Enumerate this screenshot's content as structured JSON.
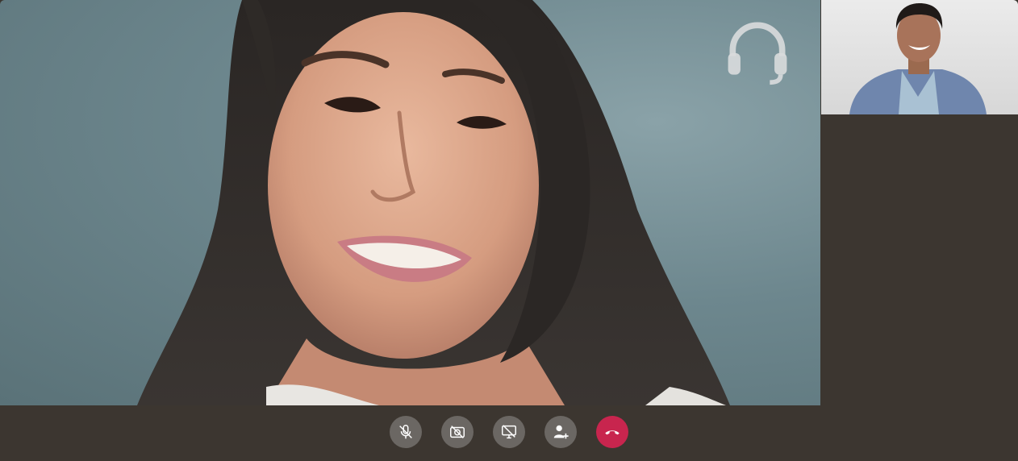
{
  "call": {
    "main_participant": {
      "video_state": "on",
      "audio_icon": "headphones-icon"
    },
    "side_participant": {
      "video_state": "on",
      "audio_icon": "headphones-icon"
    }
  },
  "controls": {
    "buttons": [
      {
        "id": "mute",
        "icon": "microphone-off-icon",
        "state": "off"
      },
      {
        "id": "camera",
        "icon": "camera-off-icon",
        "state": "off"
      },
      {
        "id": "screen-share",
        "icon": "screen-share-off-icon",
        "state": "off"
      },
      {
        "id": "add-participant",
        "icon": "add-person-icon"
      },
      {
        "id": "hang-up",
        "icon": "phone-hangup-icon"
      }
    ]
  },
  "colors": {
    "background": "#3c3630",
    "button": "#6b6763",
    "hangup": "#c8254e",
    "icon": "#ffffff"
  }
}
